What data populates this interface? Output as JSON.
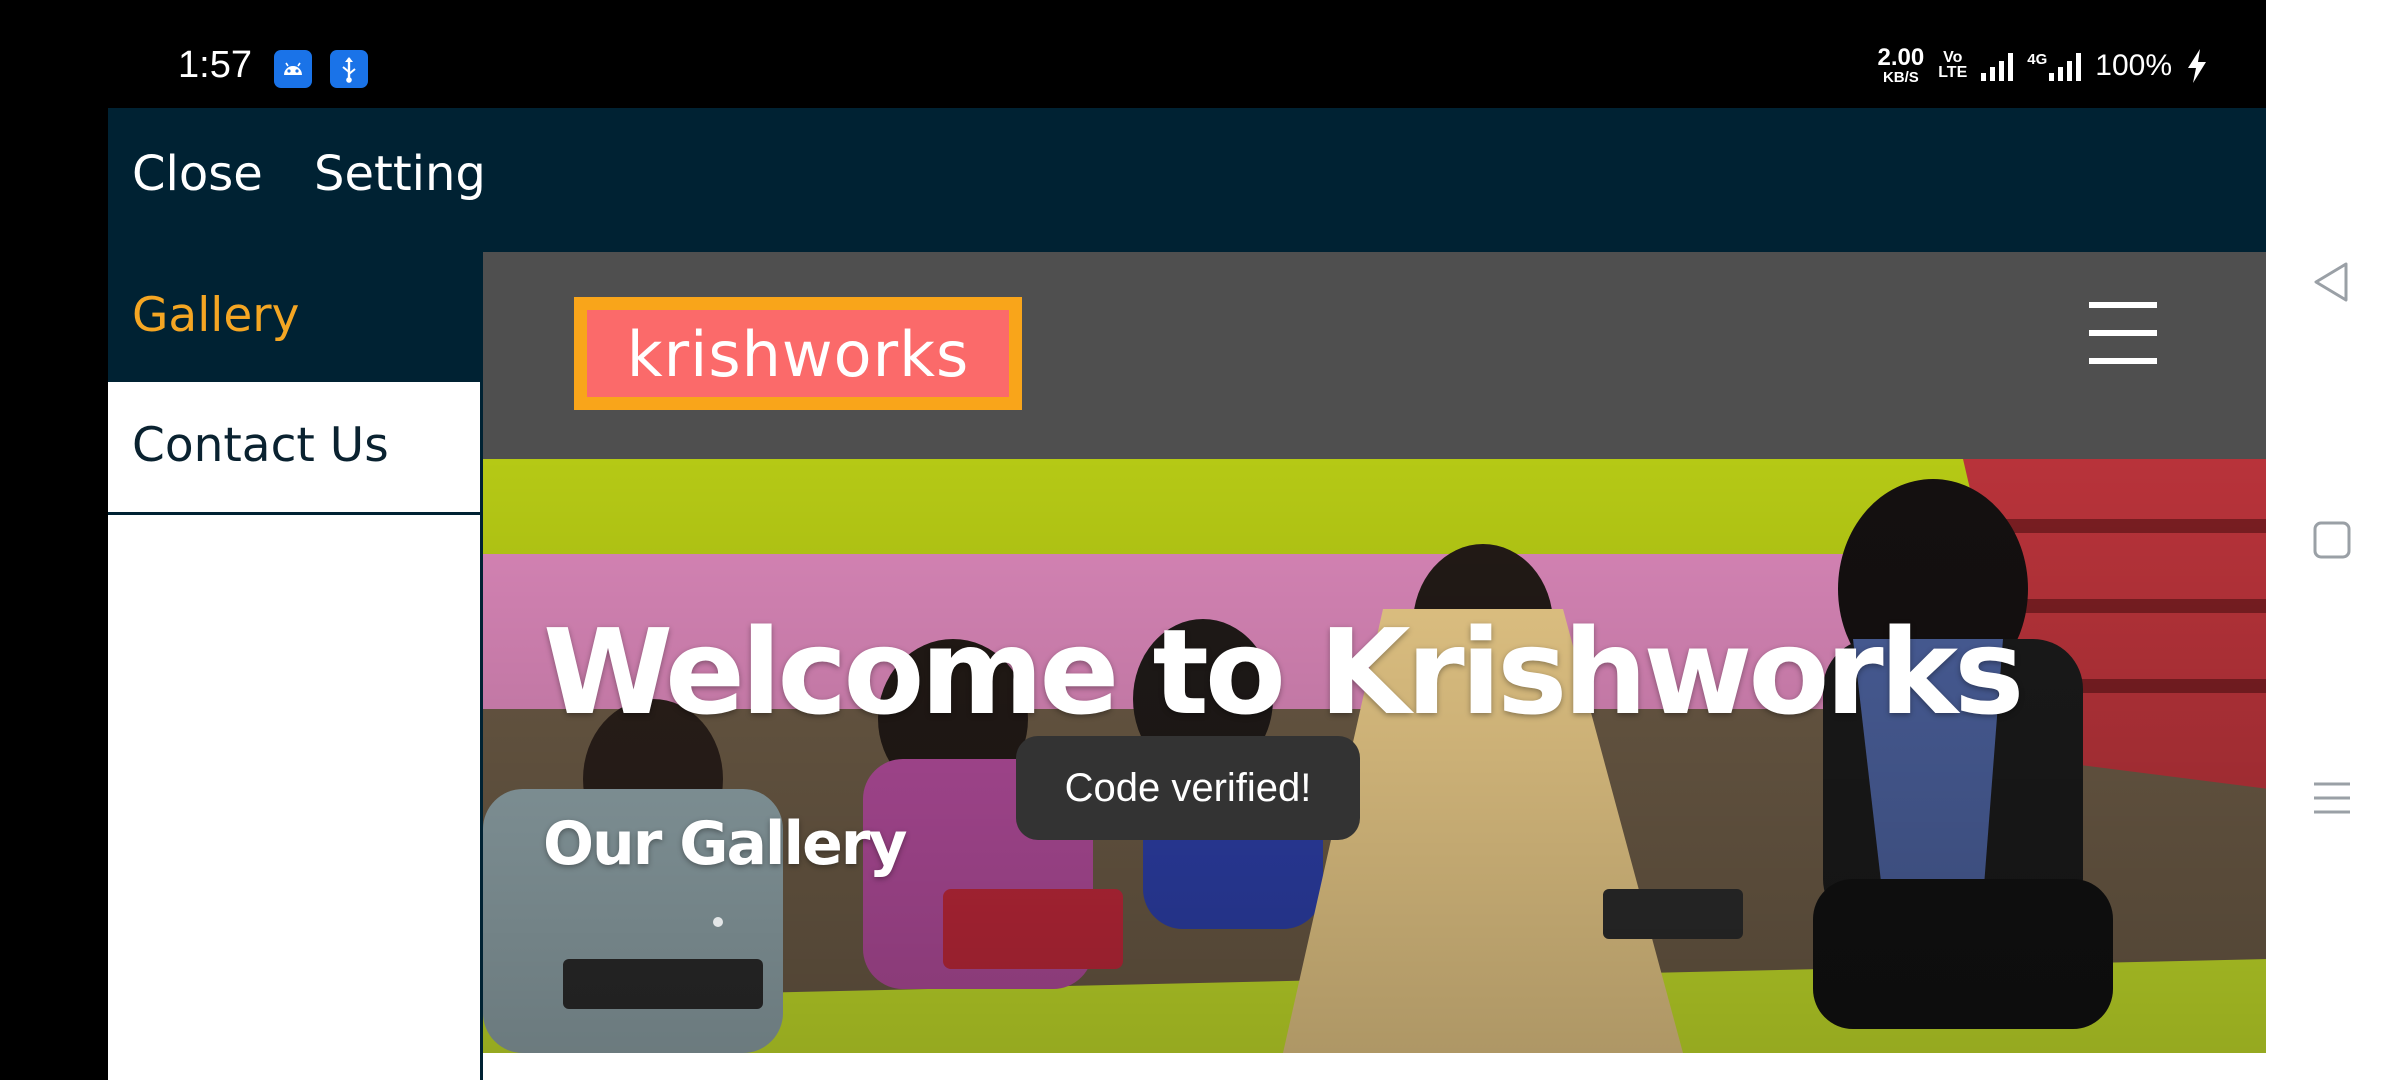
{
  "status_bar": {
    "time": "1:57",
    "icons": [
      "android-icon",
      "usb-icon"
    ],
    "net_speed_value": "2.00",
    "net_speed_unit": "KB/S",
    "volte": "Vo\nLTE",
    "network_type": "4G",
    "battery": "100%"
  },
  "toolbar": {
    "close_label": "Close",
    "setting_label": "Setting"
  },
  "sidebar": {
    "items": [
      {
        "label": "Gallery",
        "selected": true
      },
      {
        "label": "Contact Us",
        "selected": false
      }
    ]
  },
  "website": {
    "logo_text": "krishworks",
    "hero_title": "Welcome to Krishworks",
    "hero_subtitle": "Our Gallery"
  },
  "toast": {
    "message": "Code verified!"
  },
  "colors": {
    "app_bar": "#002233",
    "accent": "#f5a623",
    "logo_bg": "#fb6a6a",
    "logo_border": "#f9a51a",
    "site_header": "#4f4f4f"
  },
  "navigation_bar": {
    "icons": [
      "back-icon",
      "home-icon",
      "recents-icon"
    ]
  }
}
